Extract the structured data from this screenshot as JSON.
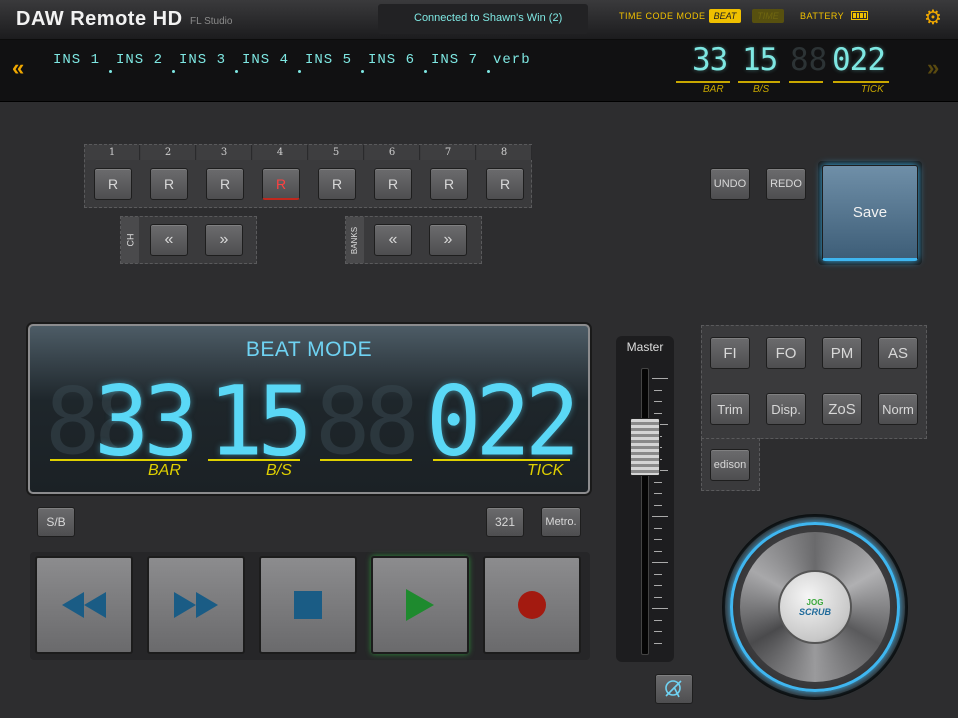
{
  "header": {
    "app_title": "DAW Remote HD",
    "app_subtitle": "FL Studio",
    "connection_status": "Connected to Shawn's Win (2)",
    "time_code_mode_label": "TIME CODE MODE",
    "tc_beat_label": "BEAT",
    "tc_time_label": "TIME",
    "battery_label": "BATTERY",
    "battery_level": 1.0,
    "settings_icon": "gear-icon"
  },
  "strip": {
    "left_arrow": "«",
    "right_arrow": "»",
    "channels": [
      "INS 1",
      "INS 2",
      "INS 3",
      "INS 4",
      "INS 5",
      "INS 6",
      "INS 7",
      "verb"
    ],
    "counter": {
      "bar": "33",
      "bs": "15",
      "tick": "022",
      "bar_label": "BAR",
      "bs_label": "B/S",
      "tick_label": "TICK"
    }
  },
  "rec_arm": {
    "numbers": [
      "1",
      "2",
      "3",
      "4",
      "5",
      "6",
      "7",
      "8"
    ],
    "button_label": "R",
    "armed_index": 3
  },
  "nav": {
    "ch_label": "CH",
    "banks_label": "BANKS",
    "prev": "«",
    "next": "»"
  },
  "edit": {
    "undo": "UNDO",
    "redo": "REDO",
    "save": "Save"
  },
  "display": {
    "mode": "BEAT MODE",
    "bar": "33",
    "bs": "15",
    "tick": "022",
    "bar_label": "BAR",
    "bs_label": "B/S",
    "tick_label": "TICK"
  },
  "small_buttons": {
    "sb": "S/B",
    "countin": "321",
    "metro": "Metro."
  },
  "transport": {
    "rewind_icon": "rewind-icon",
    "forward_icon": "fast-forward-icon",
    "stop_icon": "stop-icon",
    "play_icon": "play-icon",
    "record_icon": "record-icon",
    "colors": {
      "arrows": "#1a5c85",
      "play": "#1e8a2e",
      "record": "#a31a10"
    }
  },
  "fader": {
    "label": "Master",
    "level": 0.78
  },
  "functions": {
    "row1": [
      "FI",
      "FO",
      "PM",
      "AS"
    ],
    "row2": [
      "Trim",
      "Disp.",
      "ZoS",
      "Norm"
    ],
    "edison": "edison"
  },
  "jog": {
    "line1": "JOG",
    "line2": "SCRUB",
    "accent": "#3fb6f0"
  },
  "bottom_icon": "no-tap-icon"
}
